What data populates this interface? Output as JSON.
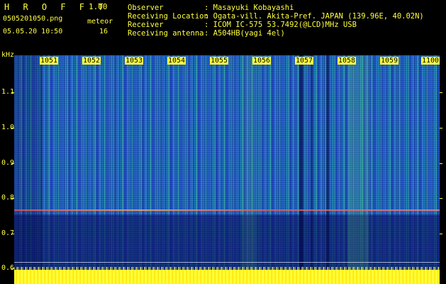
{
  "header": {
    "app_title": "H R O F F T",
    "version": "1.00",
    "filename": "0505201050.png",
    "meteor_label": "meteor",
    "datetime": "05.05.20 10:50",
    "meteor_count": "16"
  },
  "info": {
    "labels": [
      "Observer",
      "Receiving Location",
      "Receiver",
      "Receiving antenna"
    ],
    "values": [
      ": Masayuki Kobayashi",
      ": Ogata-vill. Akita-Pref. JAPAN (139.96E, 40.02N)",
      ": ICOM IC-575 53.7492(@LCD)MHz USB",
      ": A504HB(yagi 4el)"
    ]
  },
  "axes": {
    "y_unit": "kHz",
    "y_ticks": [
      "1.1",
      "1.0",
      "0.9",
      "0.8",
      "0.7",
      "0.6"
    ],
    "x_ticks": [
      "1051",
      "1052",
      "1053",
      "1054",
      "1055",
      "1056",
      "1057",
      "1058",
      "1059",
      "1100"
    ]
  },
  "colors": {
    "text": "#ffff40",
    "background": "#000000",
    "spectrum_base": "#1840b8",
    "meteor_trace": "#e05050",
    "floor": "#ffff30"
  }
}
